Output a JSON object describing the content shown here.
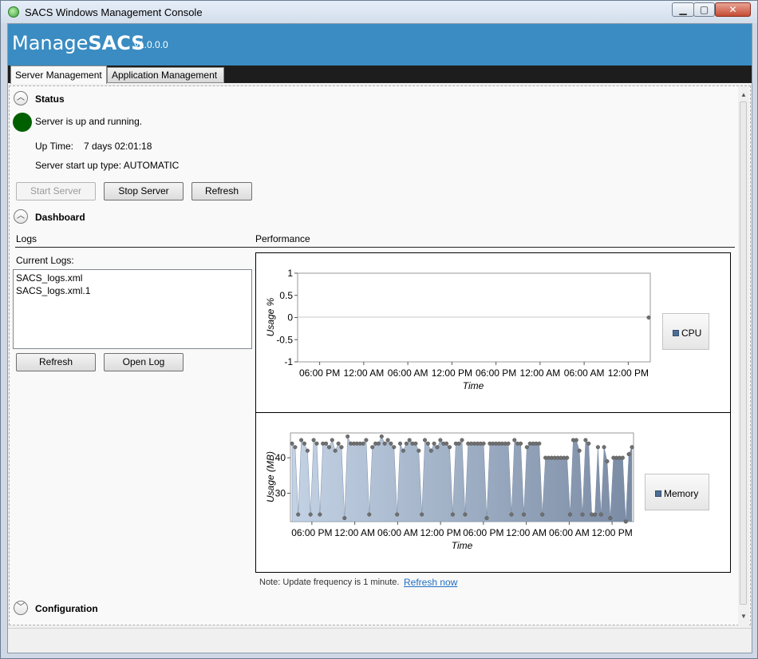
{
  "window": {
    "title": "SACS Windows Management Console",
    "controls": {
      "minimize": "▁",
      "maximize": "▢",
      "close": "✕"
    }
  },
  "header": {
    "brand_light": "Manage",
    "brand_bold": "SACS",
    "version": "v1.0.0.0",
    "brand_color": "#3a8cc2"
  },
  "tabs": [
    {
      "label": "Server Management",
      "active": true
    },
    {
      "label": "Application Management",
      "active": false
    }
  ],
  "status": {
    "section_title": "Status",
    "message": "Server is up and running.",
    "indicator_color": "#006000",
    "uptime_label": "Up Time:",
    "uptime_value": "7 days 02:01:18",
    "startup_type": "Server start up type: AUTOMATIC",
    "buttons": {
      "start": "Start Server",
      "stop": "Stop Server",
      "refresh": "Refresh"
    }
  },
  "dashboard": {
    "section_title": "Dashboard",
    "logs": {
      "heading": "Logs",
      "current_label": "Current Logs:",
      "files": [
        "SACS_logs.xml",
        "SACS_logs.xml.1"
      ],
      "buttons": {
        "refresh": "Refresh",
        "open": "Open Log"
      }
    },
    "performance": {
      "heading": "Performance",
      "note": "Note: Update frequency is 1 minute.",
      "refresh_link": "Refresh now"
    }
  },
  "configuration": {
    "section_title": "Configuration"
  },
  "scroll": {
    "up_icon": "▲",
    "down_icon": "▼"
  },
  "icons": {
    "collapse": "chevron-up-icon",
    "expand": "chevron-down-icon",
    "app": "sacs-app-icon"
  },
  "chart_data": [
    {
      "type": "line",
      "series": [
        {
          "name": "CPU",
          "values": [
            0
          ]
        }
      ],
      "x_tick_labels": [
        "06:00 PM",
        "12:00 AM",
        "06:00 AM",
        "12:00 PM",
        "06:00 PM",
        "12:00 AM",
        "06:00 AM",
        "12:00 PM"
      ],
      "y_tick_labels": [
        "1",
        "0.5",
        "0",
        "-0.5",
        "-1"
      ],
      "ylim": [
        -1,
        1
      ],
      "xlabel": "Time",
      "ylabel": "Usage %",
      "legend": "right",
      "grid": false
    },
    {
      "type": "area",
      "series": [
        {
          "name": "Memory",
          "values": [
            44,
            43,
            24,
            45,
            44,
            42,
            24,
            45,
            44,
            24,
            44,
            44,
            43,
            45,
            42,
            44,
            43,
            23,
            46,
            44,
            44,
            44,
            44,
            44,
            45,
            24,
            43,
            44,
            44,
            46,
            44,
            45,
            44,
            43,
            24,
            44,
            42,
            44,
            45,
            44,
            44,
            42,
            24,
            45,
            44,
            42,
            44,
            43,
            45,
            44,
            44,
            43,
            24,
            44,
            44,
            45,
            24,
            44,
            44,
            44,
            44,
            44,
            44,
            23,
            44,
            44,
            44,
            44,
            44,
            44,
            44,
            24,
            45,
            44,
            44,
            24,
            43,
            44,
            44,
            44,
            44,
            24,
            40,
            40,
            40,
            40,
            40,
            40,
            40,
            40,
            24,
            45,
            45,
            42,
            24,
            45,
            44,
            24,
            24,
            43,
            24,
            43,
            39,
            23,
            40,
            40,
            40,
            40,
            22,
            41,
            43
          ]
        }
      ],
      "x_tick_labels": [
        "06:00 PM",
        "12:00 AM",
        "06:00 AM",
        "12:00 PM",
        "06:00 PM",
        "12:00 AM",
        "06:00 AM",
        "12:00 PM"
      ],
      "y_tick_labels": [
        "40",
        "30"
      ],
      "ylim": [
        22,
        47
      ],
      "xlabel": "Time",
      "ylabel": "Usage (MB)",
      "legend": "right",
      "grid": false
    }
  ]
}
